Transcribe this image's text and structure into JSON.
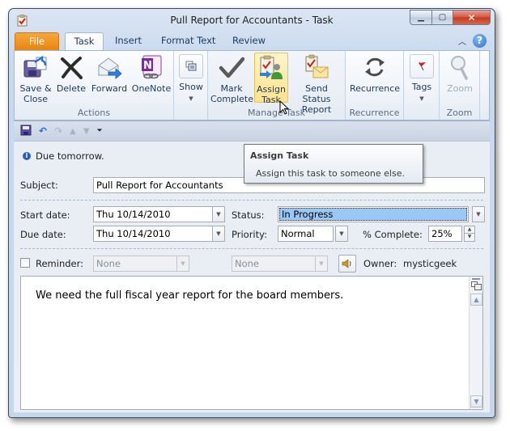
{
  "window": {
    "title": "Pull Report for Accountants  -  Task",
    "controls": {
      "minimize": "minimize",
      "maximize": "maximize",
      "close": "close"
    }
  },
  "tabs": [
    {
      "label": "File"
    },
    {
      "label": "Task"
    },
    {
      "label": "Insert"
    },
    {
      "label": "Format Text"
    },
    {
      "label": "Review"
    }
  ],
  "ribbon": {
    "groups": [
      {
        "label": "Actions",
        "buttons": [
          {
            "label_line1": "Save &",
            "label_line2": "Close",
            "icon": "save-close-icon"
          },
          {
            "label_line1": "Delete",
            "icon": "delete-icon"
          },
          {
            "label_line1": "Forward",
            "icon": "forward-icon"
          },
          {
            "label_line1": "OneNote",
            "icon": "onenote-icon"
          }
        ]
      },
      {
        "label": "",
        "buttons": [
          {
            "label_line1": "Show",
            "icon": "show-icon"
          }
        ]
      },
      {
        "label": "Manage Task",
        "buttons": [
          {
            "label_line1": "Mark",
            "label_line2": "Complete",
            "icon": "checkmark-icon"
          },
          {
            "label_line1": "Assign",
            "label_line2": "Task",
            "icon": "assign-task-icon"
          },
          {
            "label_line1": "Send Status",
            "label_line2": "Report",
            "icon": "send-status-icon"
          }
        ]
      },
      {
        "label": "Recurrence",
        "buttons": [
          {
            "label_line1": "Recurrence",
            "icon": "recurrence-icon"
          }
        ]
      },
      {
        "label": "",
        "buttons": [
          {
            "label_line1": "Tags",
            "icon": "flag-icon"
          }
        ]
      },
      {
        "label": "Zoom",
        "buttons": [
          {
            "label_line1": "Zoom",
            "icon": "magnifier-icon"
          }
        ]
      }
    ]
  },
  "tooltip": {
    "title": "Assign Task",
    "body": "Assign this task to someone else."
  },
  "form": {
    "info": "Due tomorrow.",
    "subject_label": "Subject:",
    "subject_value": "Pull Report for Accountants",
    "start_date_label": "Start date:",
    "start_date_value": "Thu 10/14/2010",
    "due_date_label": "Due date:",
    "due_date_value": "Thu 10/14/2010",
    "status_label": "Status:",
    "status_value": "In Progress",
    "priority_label": "Priority:",
    "priority_value": "Normal",
    "percent_label": "% Complete:",
    "percent_value": "25%",
    "reminder_label": "Reminder:",
    "reminder_checked": false,
    "reminder_date": "None",
    "reminder_time": "None",
    "owner_label": "Owner:",
    "owner_value": "mysticgeek",
    "notes": "We need the full fiscal year report for the board members."
  },
  "colors": {
    "file_tab": "#e8850f",
    "status_highlight": "#99c8f8",
    "hover_button": "#ffe38f"
  }
}
